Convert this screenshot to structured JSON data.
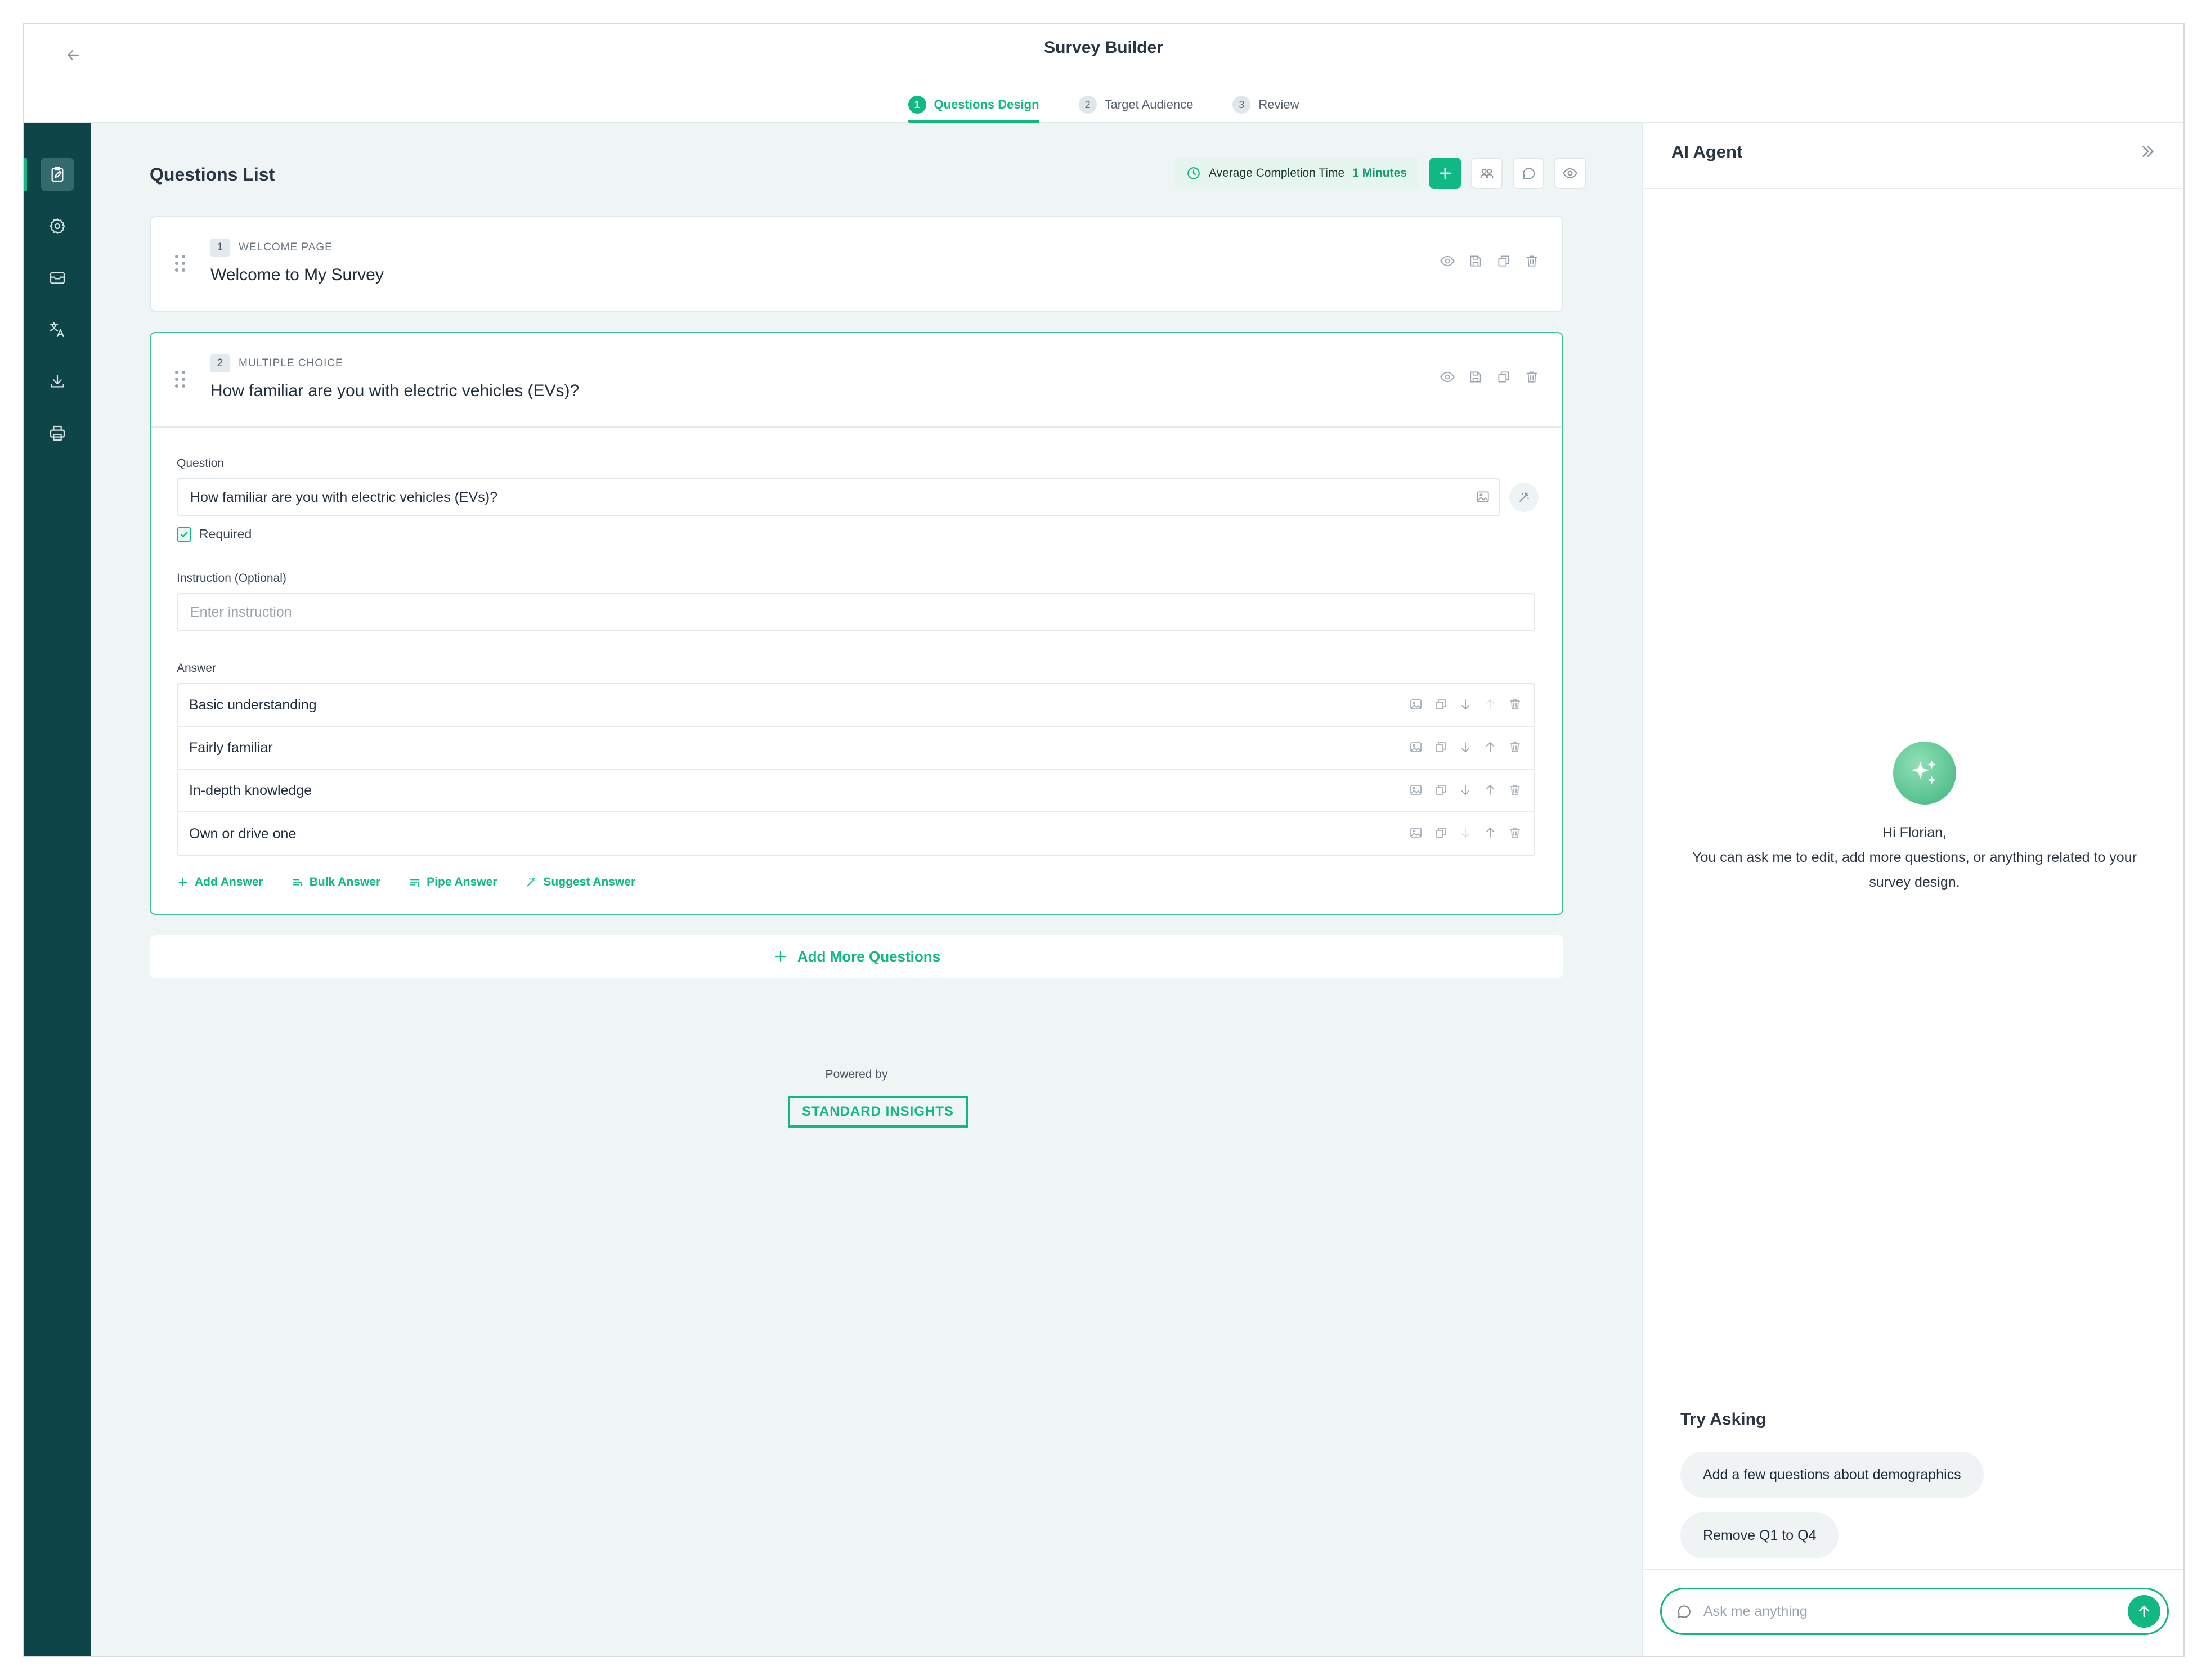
{
  "app": {
    "title": "Survey Builder"
  },
  "steps": [
    {
      "num": "1",
      "label": "Questions Design",
      "active": true
    },
    {
      "num": "2",
      "label": "Target Audience",
      "active": false
    },
    {
      "num": "3",
      "label": "Review",
      "active": false
    }
  ],
  "sidenav": {
    "items": [
      {
        "icon": "clipboard-edit-icon",
        "active": true
      },
      {
        "icon": "gear-icon",
        "active": false
      },
      {
        "icon": "inbox-icon",
        "active": false
      },
      {
        "icon": "translate-icon",
        "active": false
      },
      {
        "icon": "download-icon",
        "active": false
      },
      {
        "icon": "printer-icon",
        "active": false
      }
    ]
  },
  "main": {
    "title": "Questions List",
    "avg_completion": {
      "label": "Average Completion Time",
      "value": "1 Minutes"
    },
    "toolbar_icons": [
      "plus-icon",
      "users-icon",
      "comment-icon",
      "eye-icon"
    ]
  },
  "questions": [
    {
      "num": "1",
      "type": "WELCOME PAGE",
      "title": "Welcome to My Survey"
    },
    {
      "num": "2",
      "type": "MULTIPLE CHOICE",
      "title": "How familiar are you with electric vehicles (EVs)?",
      "question_label": "Question",
      "question_value": "How familiar are you with electric vehicles (EVs)?",
      "required_label": "Required",
      "required": true,
      "instruction_label": "Instruction (Optional)",
      "instruction_placeholder": "Enter instruction",
      "answer_label": "Answer",
      "answers": [
        "Basic understanding",
        "Fairly familiar",
        "In-depth knowledge",
        "Own or drive one"
      ],
      "answer_links": [
        "Add Answer",
        "Bulk Answer",
        "Pipe Answer",
        "Suggest Answer"
      ]
    }
  ],
  "add_more_label": "Add More Questions",
  "footer": {
    "powered_by": "Powered by",
    "brand": "STANDARD INSIGHTS"
  },
  "agent": {
    "title": "AI Agent",
    "greeting_line1": "Hi Florian,",
    "greeting_line2": "You can ask me to edit, add more questions, or anything related to your survey design.",
    "try_title": "Try Asking",
    "suggestions": [
      "Add a few questions about demographics",
      "Remove Q1 to Q4"
    ],
    "input_placeholder": "Ask me anything"
  },
  "colors": {
    "accent": "#10b981",
    "nav_bg": "#0e4549",
    "main_bg": "#eff5f5"
  }
}
